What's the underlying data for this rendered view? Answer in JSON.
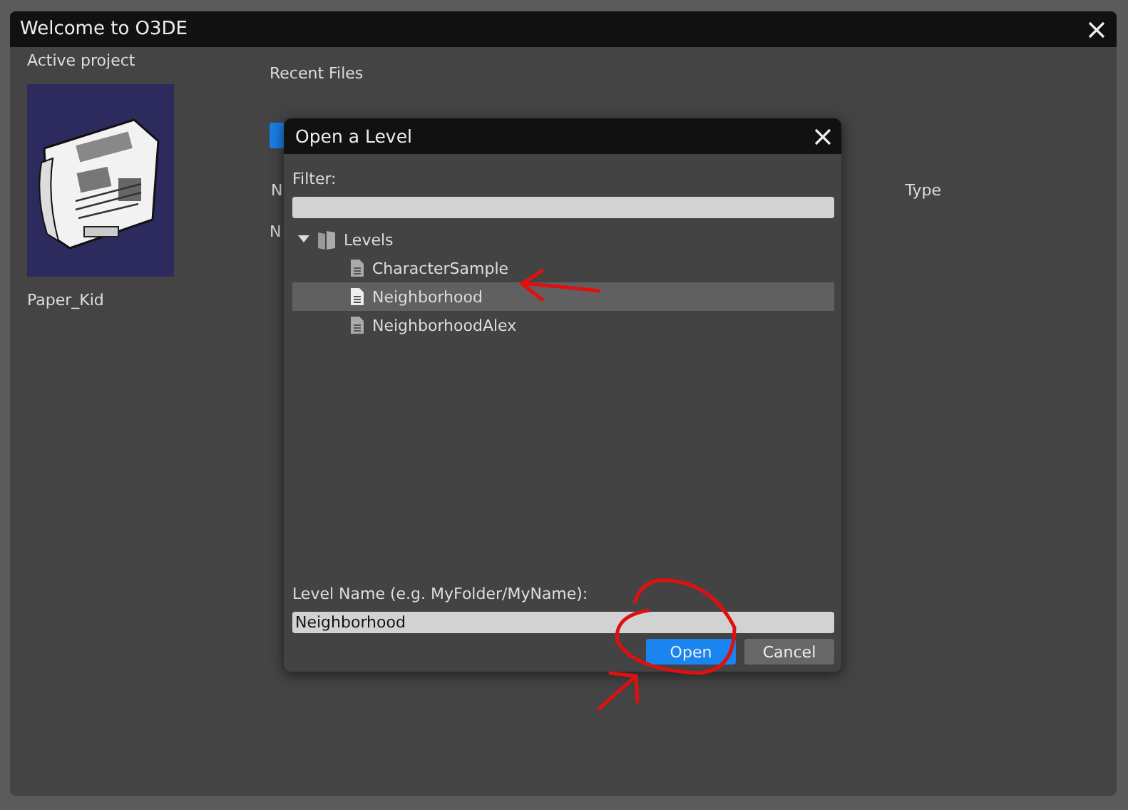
{
  "window": {
    "title": "Welcome to O3DE"
  },
  "project": {
    "heading": "Active project",
    "name": "Paper_Kid"
  },
  "recent": {
    "heading": "Recent Files",
    "columns": [
      "N",
      "Type"
    ],
    "row_text": "N"
  },
  "dialog": {
    "title": "Open a Level",
    "filter_label": "Filter:",
    "tree": [
      {
        "label": "Levels",
        "expanded": true,
        "kind": "folder",
        "selected": false,
        "children": [
          {
            "label": "CharacterSample",
            "kind": "file",
            "selected": false
          },
          {
            "label": "Neighborhood",
            "kind": "file",
            "selected": true
          },
          {
            "label": "NeighborhoodAlex",
            "kind": "file",
            "selected": false
          }
        ]
      }
    ],
    "name_label": "Level Name (e.g. MyFolder/MyName):",
    "name_value": "Neighborhood",
    "buttons": [
      {
        "label": "Open",
        "kind": "primary"
      },
      {
        "label": "Cancel",
        "kind": "secondary"
      }
    ]
  }
}
